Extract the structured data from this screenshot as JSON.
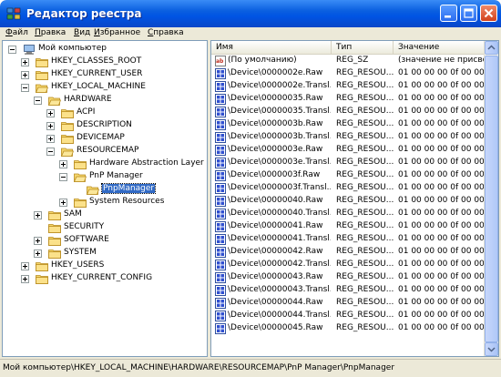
{
  "window": {
    "title": "Редактор реестра",
    "app_icon": "regedit-icon",
    "controls": [
      "minimize-icon",
      "maximize-icon",
      "close-icon"
    ]
  },
  "menu": [
    {
      "underline": "Ф",
      "rest": "айл"
    },
    {
      "underline": "П",
      "rest": "равка"
    },
    {
      "underline": "В",
      "rest": "ид"
    },
    {
      "underline": "И",
      "rest": "збранное"
    },
    {
      "underline": "С",
      "rest": "правка"
    }
  ],
  "tree": [
    {
      "label": "Мой компьютер",
      "level": 0,
      "icon": "computer-icon",
      "expander": "minus"
    },
    {
      "label": "HKEY_CLASSES_ROOT",
      "level": 1,
      "icon": "folder-icon",
      "expander": "plus"
    },
    {
      "label": "HKEY_CURRENT_USER",
      "level": 1,
      "icon": "folder-icon",
      "expander": "plus"
    },
    {
      "label": "HKEY_LOCAL_MACHINE",
      "level": 1,
      "icon": "folder-open-icon",
      "expander": "minus"
    },
    {
      "label": "HARDWARE",
      "level": 2,
      "icon": "folder-open-icon",
      "expander": "minus"
    },
    {
      "label": "ACPI",
      "level": 3,
      "icon": "folder-icon",
      "expander": "plus"
    },
    {
      "label": "DESCRIPTION",
      "level": 3,
      "icon": "folder-icon",
      "expander": "plus"
    },
    {
      "label": "DEVICEMAP",
      "level": 3,
      "icon": "folder-icon",
      "expander": "plus"
    },
    {
      "label": "RESOURCEMAP",
      "level": 3,
      "icon": "folder-open-icon",
      "expander": "minus"
    },
    {
      "label": "Hardware Abstraction Layer",
      "level": 4,
      "icon": "folder-icon",
      "expander": "plus"
    },
    {
      "label": "PnP Manager",
      "level": 4,
      "icon": "folder-open-icon",
      "expander": "minus"
    },
    {
      "label": "PnpManager",
      "level": 5,
      "icon": "folder-open-icon",
      "expander": "none",
      "selected": true
    },
    {
      "label": "System Resources",
      "level": 4,
      "icon": "folder-icon",
      "expander": "plus"
    },
    {
      "label": "SAM",
      "level": 2,
      "icon": "folder-icon",
      "expander": "plus"
    },
    {
      "label": "SECURITY",
      "level": 2,
      "icon": "folder-icon",
      "expander": "none"
    },
    {
      "label": "SOFTWARE",
      "level": 2,
      "icon": "folder-icon",
      "expander": "plus"
    },
    {
      "label": "SYSTEM",
      "level": 2,
      "icon": "folder-icon",
      "expander": "plus"
    },
    {
      "label": "HKEY_USERS",
      "level": 1,
      "icon": "folder-icon",
      "expander": "plus"
    },
    {
      "label": "HKEY_CURRENT_CONFIG",
      "level": 1,
      "icon": "folder-icon",
      "expander": "plus"
    }
  ],
  "list": {
    "columns": [
      "Имя",
      "Тип",
      "Значение"
    ],
    "rows": [
      {
        "icon": "string-value-icon",
        "name": "(По умолчанию)",
        "type": "REG_SZ",
        "value": "(значение не присвое"
      },
      {
        "icon": "binary-value-icon",
        "name": "\\Device\\0000002e.Raw",
        "type": "REG_RESOU...",
        "value": "01 00 00 00 0f 00 00 0"
      },
      {
        "icon": "binary-value-icon",
        "name": "\\Device\\0000002e.Transl...",
        "type": "REG_RESOU...",
        "value": "01 00 00 00 0f 00 00 0"
      },
      {
        "icon": "binary-value-icon",
        "name": "\\Device\\00000035.Raw",
        "type": "REG_RESOU...",
        "value": "01 00 00 00 0f 00 00 0"
      },
      {
        "icon": "binary-value-icon",
        "name": "\\Device\\00000035.Transl...",
        "type": "REG_RESOU...",
        "value": "01 00 00 00 0f 00 00 0"
      },
      {
        "icon": "binary-value-icon",
        "name": "\\Device\\0000003b.Raw",
        "type": "REG_RESOU...",
        "value": "01 00 00 00 0f 00 00 0"
      },
      {
        "icon": "binary-value-icon",
        "name": "\\Device\\0000003b.Transl...",
        "type": "REG_RESOU...",
        "value": "01 00 00 00 0f 00 00 0"
      },
      {
        "icon": "binary-value-icon",
        "name": "\\Device\\0000003e.Raw",
        "type": "REG_RESOU...",
        "value": "01 00 00 00 0f 00 00 0"
      },
      {
        "icon": "binary-value-icon",
        "name": "\\Device\\0000003e.Transl...",
        "type": "REG_RESOU...",
        "value": "01 00 00 00 0f 00 00 0"
      },
      {
        "icon": "binary-value-icon",
        "name": "\\Device\\0000003f.Raw",
        "type": "REG_RESOU...",
        "value": "01 00 00 00 0f 00 00 0"
      },
      {
        "icon": "binary-value-icon",
        "name": "\\Device\\0000003f.Transl...",
        "type": "REG_RESOU...",
        "value": "01 00 00 00 0f 00 00 0"
      },
      {
        "icon": "binary-value-icon",
        "name": "\\Device\\00000040.Raw",
        "type": "REG_RESOU...",
        "value": "01 00 00 00 0f 00 00 0"
      },
      {
        "icon": "binary-value-icon",
        "name": "\\Device\\00000040.Transl...",
        "type": "REG_RESOU...",
        "value": "01 00 00 00 0f 00 00 0"
      },
      {
        "icon": "binary-value-icon",
        "name": "\\Device\\00000041.Raw",
        "type": "REG_RESOU...",
        "value": "01 00 00 00 0f 00 00 0"
      },
      {
        "icon": "binary-value-icon",
        "name": "\\Device\\00000041.Transl...",
        "type": "REG_RESOU...",
        "value": "01 00 00 00 0f 00 00 0"
      },
      {
        "icon": "binary-value-icon",
        "name": "\\Device\\00000042.Raw",
        "type": "REG_RESOU...",
        "value": "01 00 00 00 0f 00 00 0"
      },
      {
        "icon": "binary-value-icon",
        "name": "\\Device\\00000042.Transl...",
        "type": "REG_RESOU...",
        "value": "01 00 00 00 0f 00 00 0"
      },
      {
        "icon": "binary-value-icon",
        "name": "\\Device\\00000043.Raw",
        "type": "REG_RESOU...",
        "value": "01 00 00 00 0f 00 00 0"
      },
      {
        "icon": "binary-value-icon",
        "name": "\\Device\\00000043.Transl...",
        "type": "REG_RESOU...",
        "value": "01 00 00 00 0f 00 00 0"
      },
      {
        "icon": "binary-value-icon",
        "name": "\\Device\\00000044.Raw",
        "type": "REG_RESOU...",
        "value": "01 00 00 00 0f 00 00 0"
      },
      {
        "icon": "binary-value-icon",
        "name": "\\Device\\00000044.Transl...",
        "type": "REG_RESOU...",
        "value": "01 00 00 00 0f 00 00 0"
      },
      {
        "icon": "binary-value-icon",
        "name": "\\Device\\00000045.Raw",
        "type": "REG_RESOU...",
        "value": "01 00 00 00 0f 00 00 0"
      }
    ]
  },
  "status": "Мой компьютер\\HKEY_LOCAL_MACHINE\\HARDWARE\\RESOURCEMAP\\PnP Manager\\PnpManager",
  "colors": {
    "title_bar": "#0054e3",
    "selection": "#316ac5",
    "window_face": "#ece9d8"
  }
}
